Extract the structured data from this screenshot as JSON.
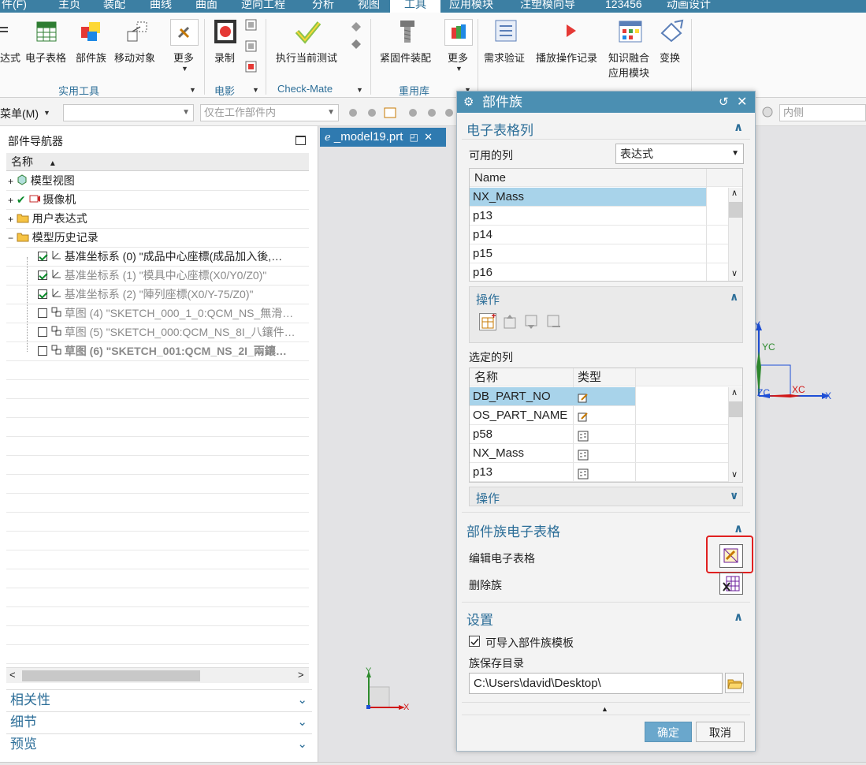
{
  "menubar": {
    "items": [
      {
        "label": "件(F)",
        "active": false
      },
      {
        "label": "主页",
        "active": false
      },
      {
        "label": "装配",
        "active": false
      },
      {
        "label": "曲线",
        "active": false
      },
      {
        "label": "曲面",
        "active": false
      },
      {
        "label": "逆向工程",
        "active": false
      },
      {
        "label": "分析",
        "active": false
      },
      {
        "label": "视图",
        "active": false
      },
      {
        "label": "工具",
        "active": true
      },
      {
        "label": "应用模块",
        "active": false
      },
      {
        "label": "注塑模向导",
        "active": false
      },
      {
        "label": "123456",
        "active": false
      },
      {
        "label": "动画设计",
        "active": false
      }
    ]
  },
  "ribbon": {
    "buttons": {
      "expr": "达式",
      "spreadsheet": "电子表格",
      "part_family": "部件族",
      "move_object": "移动对象",
      "more1": "更多",
      "record": "录制",
      "run_test": "执行当前测试",
      "fastener": "紧固件装配",
      "more2": "更多",
      "req_verify": "需求验证",
      "playback": "播放操作记录",
      "knowledge_fusion": "知识融合",
      "knowledge_fusion_2": "应用模块",
      "transform": "变换"
    },
    "groups": {
      "utility": "实用工具",
      "movie": "电影",
      "checkmate": "Check-Mate",
      "reuse": "重用库"
    }
  },
  "cmdbar": {
    "menu_label": "菜单(M)",
    "scope_placeholder": "仅在工作部件内",
    "inside_placeholder": "内侧"
  },
  "navigator": {
    "title": "部件导航器",
    "column_name": "名称",
    "tree": [
      {
        "label": "模型视图",
        "style": "normal"
      },
      {
        "label": "摄像机",
        "style": "normal"
      },
      {
        "label": "用户表达式",
        "style": "normal"
      },
      {
        "label": "模型历史记录",
        "style": "normal"
      },
      {
        "label": "基准坐标系 (0) \"成品中心座標(成品加入後,…",
        "style": "normal"
      },
      {
        "label": "基准坐标系 (1) \"模具中心座標(X0/Y0/Z0)\"",
        "style": "grey"
      },
      {
        "label": "基准坐标系 (2) \"陣列座標(X0/Y-75/Z0)\"",
        "style": "grey"
      },
      {
        "label": "草图 (4) \"SKETCH_000_1_0:QCM_NS_無滑…",
        "style": "grey"
      },
      {
        "label": "草图 (5) \"SKETCH_000:QCM_NS_8I_八鑲件…",
        "style": "grey"
      },
      {
        "label": "草图 (6) \"SKETCH_001:QCM_NS_2I_兩鑲…",
        "style": "greybold"
      }
    ],
    "panels": [
      "相关性",
      "细节",
      "预览"
    ]
  },
  "viewport": {
    "tab_label": "_model19.prt",
    "axis_labels": {
      "y": "Y",
      "yc": "YC",
      "zc": "ZC",
      "xc": "XC",
      "x": "X"
    },
    "small_axis": {
      "y": "Y",
      "x": "X"
    }
  },
  "dialog": {
    "title": "部件族",
    "spreadsheet_columns": {
      "header": "电子表格列",
      "available_label": "可用的列",
      "available_value": "表达式",
      "list_header": "Name",
      "list": [
        "NX_Mass",
        "p13",
        "p14",
        "p15",
        "p16"
      ],
      "ops_header": "操作"
    },
    "selected_columns": {
      "label": "选定的列",
      "col_name": "名称",
      "col_type": "类型",
      "rows": [
        "DB_PART_NO",
        "OS_PART_NAME",
        "p58",
        "NX_Mass",
        "p13"
      ],
      "ops_header": "操作"
    },
    "family_spreadsheet": {
      "header": "部件族电子表格",
      "edit_label": "编辑电子表格",
      "delete_label": "删除族"
    },
    "settings": {
      "header": "设置",
      "import_template_label": "可导入部件族模板",
      "import_template_checked": true,
      "save_dir_label": "族保存目录",
      "save_dir_value": "C:\\Users\\david\\Desktop\\"
    },
    "ok_label": "确定",
    "cancel_label": "取消"
  },
  "colors": {
    "accent": "#2c6e98",
    "titlebar": "#4b8fb2",
    "selection": "#a8d3ea",
    "highlight_box": "#e02020"
  }
}
